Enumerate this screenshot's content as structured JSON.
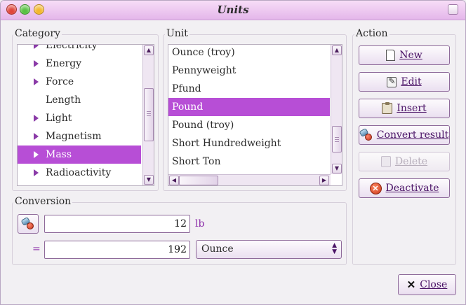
{
  "window": {
    "title": "Units"
  },
  "category": {
    "label": "Category",
    "items": [
      {
        "label": "Electricity",
        "expandable": true,
        "selected": false
      },
      {
        "label": "Energy",
        "expandable": true,
        "selected": false
      },
      {
        "label": "Force",
        "expandable": true,
        "selected": false
      },
      {
        "label": "Length",
        "expandable": false,
        "selected": false
      },
      {
        "label": "Light",
        "expandable": true,
        "selected": false
      },
      {
        "label": "Magnetism",
        "expandable": true,
        "selected": false
      },
      {
        "label": "Mass",
        "expandable": true,
        "selected": true
      },
      {
        "label": "Radioactivity",
        "expandable": true,
        "selected": false
      }
    ]
  },
  "unit": {
    "label": "Unit",
    "items": [
      {
        "label": "Ounce (troy)",
        "selected": false
      },
      {
        "label": "Pennyweight",
        "selected": false
      },
      {
        "label": "Pfund",
        "selected": false
      },
      {
        "label": "Pound",
        "selected": true
      },
      {
        "label": "Pound (troy)",
        "selected": false
      },
      {
        "label": "Short Hundredweight",
        "selected": false
      },
      {
        "label": "Short Ton",
        "selected": false
      }
    ]
  },
  "action": {
    "label": "Action",
    "new_label": "New",
    "edit_label": "Edit",
    "insert_label": "Insert",
    "convert_label": "Convert result",
    "delete_label": "Delete",
    "deactivate_label": "Deactivate"
  },
  "conversion": {
    "label": "Conversion",
    "input_value": "12",
    "input_unit": "lb",
    "equals_sign": "=",
    "result_value": "192",
    "target_unit": "Ounce"
  },
  "footer": {
    "close_label": "Close"
  },
  "colors": {
    "selection": "#b74ed6",
    "accent": "#4a1366",
    "titlebar": "#e4b6ea"
  }
}
